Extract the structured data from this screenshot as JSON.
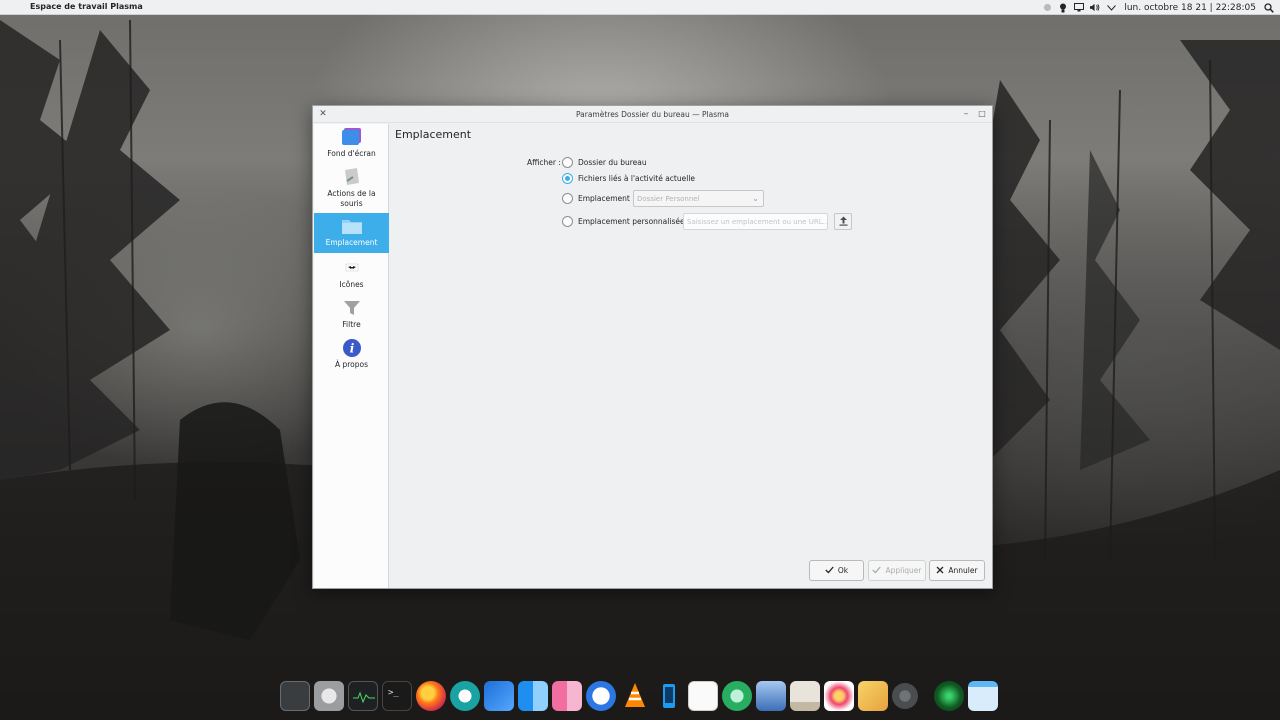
{
  "top_panel": {
    "title": "Espace de travail Plasma",
    "clock": "lun. octobre 18 21 | 22:28:05",
    "tray_icons": [
      "network-status-icon",
      "notification-bulb-icon",
      "display-icon",
      "volume-icon",
      "chevron-down-icon",
      "search-icon"
    ]
  },
  "window": {
    "title": "Paramètres Dossier du bureau — Plasma",
    "close_glyph": "✕",
    "minimize_glyph": "–",
    "maximize_glyph": "□"
  },
  "sidebar": {
    "items": [
      {
        "label": "Fond d'écran",
        "icon": "wallpaper-icon"
      },
      {
        "label": "Actions de la souris",
        "icon": "mouse-icon"
      },
      {
        "label": "Emplacement",
        "icon": "folder-icon"
      },
      {
        "label": "Icônes",
        "icon": "icons-icon"
      },
      {
        "label": "Filtre",
        "icon": "filter-icon"
      },
      {
        "label": "À propos",
        "icon": "info-icon"
      }
    ]
  },
  "page": {
    "title": "Emplacement",
    "show_label": "Afficher :",
    "options": {
      "desktop": "Dossier du bureau",
      "activity": "Fichiers liés à l'activité actuelle",
      "location": "Emplacement :",
      "custom": "Emplacement personnalisée :"
    },
    "selected_option": "activity",
    "location_combo_value": "Dossier Personnel",
    "custom_placeholder": "Saisissez un emplacement ou une URL..."
  },
  "buttons": {
    "ok": "Ok",
    "apply": "Appliquer",
    "cancel": "Annuler"
  },
  "dock": {
    "apps": [
      "device-icon",
      "system-settings-icon",
      "system-monitor-icon",
      "terminal-icon",
      "firefox-icon",
      "app-store-icon",
      "widgets-icon",
      "finder-icon",
      "launchpad-icon",
      "signal-icon",
      "vlc-icon",
      "kdeconnect-icon",
      "text-editor-icon",
      "tools-icon",
      "image-viewer-icon",
      "calendar-icon",
      "photos-icon",
      "notes-icon",
      "settings-gear-icon",
      "radar-icon",
      "window-icon"
    ]
  },
  "colors": {
    "accent": "#3daee9",
    "panel_bg": "#eff0f1"
  }
}
